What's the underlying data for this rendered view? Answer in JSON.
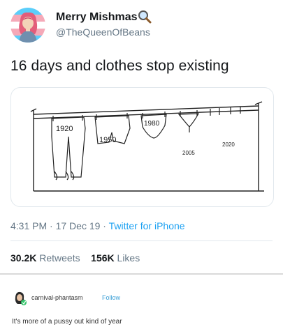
{
  "tweet": {
    "display_name": "Merry Mishmas",
    "badge_icon": "magnifying-glass-icon",
    "handle": "@TheQueenOfBeans",
    "text": "16 days and clothes stop existing",
    "timestamp": "4:31 PM · 17 Dec 19",
    "source": "Twitter for iPhone",
    "retweets_count": "30.2K",
    "retweets_label": "Retweets",
    "likes_count": "156K",
    "likes_label": "Likes",
    "image": {
      "year_1920": "1920",
      "year_1950": "1950",
      "year_1980": "1980",
      "year_2005": "2005",
      "year_2020": "2020"
    }
  },
  "reblog": {
    "username": "carnival-phantasm",
    "follow_label": "Follow",
    "text": "It's more of a pussy out kind of year"
  },
  "colors": {
    "link_blue": "#1da1f2",
    "muted_gray": "#657786",
    "follow_blue": "#3a9fd6"
  }
}
